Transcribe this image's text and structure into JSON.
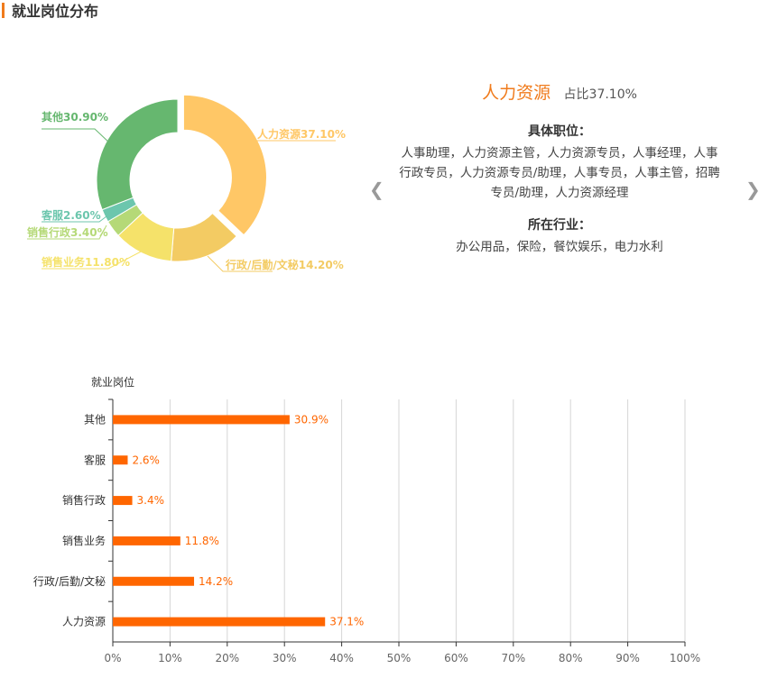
{
  "section_title": "就业岗位分布",
  "colors": {
    "accent": "#f07b1c",
    "bar": "#ff6600"
  },
  "info_panel": {
    "name": "人力资源",
    "ratio": "占比37.10%",
    "positions_label": "具体职位：",
    "positions": "人事助理，人力资源主管，人力资源专员，人事经理，人事行政专员，人力资源专员/助理，人事专员，人事主管，招聘专员/助理，人力资源经理",
    "industry_label": "所在行业：",
    "industries": "办公用品，保险，餐饮娱乐，电力水利",
    "prev_icon": "chevron-left-icon",
    "next_icon": "chevron-right-icon"
  },
  "chart_data": [
    {
      "type": "pie",
      "slices": [
        {
          "label": "人力资源37.10%",
          "category": "人力资源",
          "value": 37.1,
          "color": "#ffc766",
          "selected": true
        },
        {
          "label": "行政/后勤/文秘14.20%",
          "category": "行政/后勤/文秘",
          "value": 14.2,
          "color": "#f3cb63"
        },
        {
          "label": "销售业务11.80%",
          "category": "销售业务",
          "value": 11.8,
          "color": "#f5e26a"
        },
        {
          "label": "销售行政3.40%",
          "category": "销售行政",
          "value": 3.4,
          "color": "#b5d977"
        },
        {
          "label": "客服2.60%",
          "category": "客服",
          "value": 2.6,
          "color": "#6cc6ad"
        },
        {
          "label": "其他30.90%",
          "category": "其他",
          "value": 30.9,
          "color": "#66b76f"
        }
      ]
    },
    {
      "type": "bar",
      "orientation": "horizontal",
      "ylabel": "就业岗位",
      "categories": [
        "其他",
        "客服",
        "销售行政",
        "销售业务",
        "行政/后勤/文秘",
        "人力资源"
      ],
      "values": [
        30.9,
        2.6,
        3.4,
        11.8,
        14.2,
        37.1
      ],
      "value_labels": [
        "30.9%",
        "2.6%",
        "3.4%",
        "11.8%",
        "14.2%",
        "37.1%"
      ],
      "xlim": [
        0,
        100
      ],
      "xticks": [
        "0%",
        "10%",
        "20%",
        "30%",
        "40%",
        "50%",
        "60%",
        "70%",
        "80%",
        "90%",
        "100%"
      ],
      "grid": true
    }
  ]
}
